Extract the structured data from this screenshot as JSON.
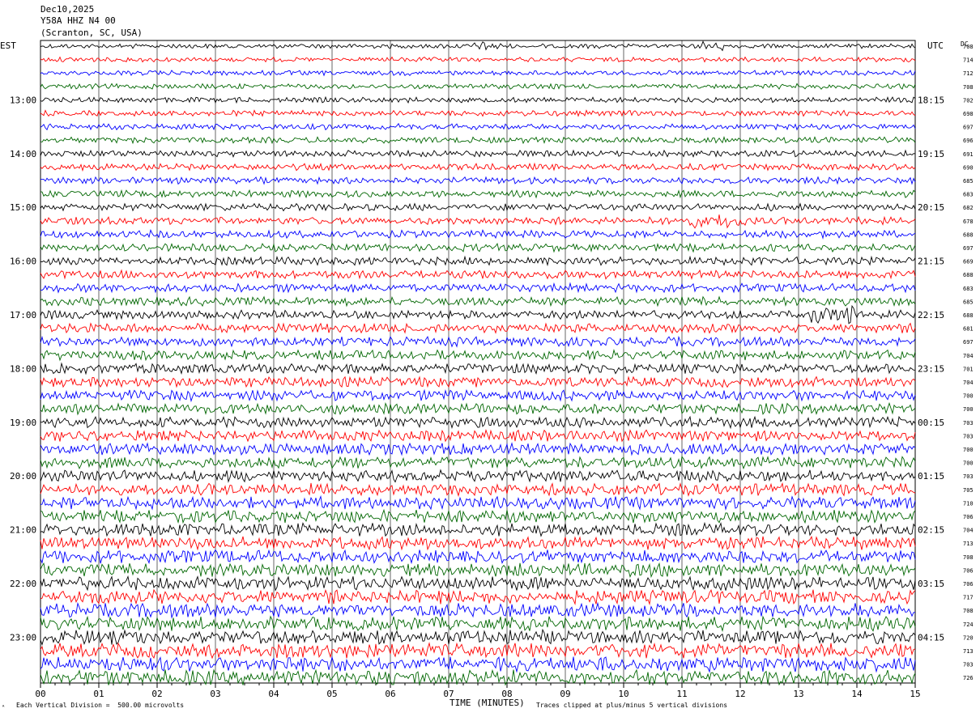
{
  "header": {
    "date": "Dec10,2025",
    "station": "Y58A HHZ N4 00",
    "location": "(Scranton, SC, USA)"
  },
  "left_zone_label": "EST",
  "right_zone_label": "UTC",
  "dc_label": "DC",
  "footer": {
    "x_axis_title": "TIME (MINUTES)",
    "vertical_division": "Each Vertical Division =  500.00 microvolts",
    "clip_note": "Traces clipped at plus/minus 5 vertical divisions"
  },
  "chart_data": {
    "type": "line",
    "title": "",
    "xlabel": "TIME (MINUTES)",
    "ylabel": "",
    "xlim": [
      0,
      15
    ],
    "x_ticks": [
      "00",
      "01",
      "02",
      "03",
      "04",
      "05",
      "06",
      "07",
      "08",
      "09",
      "10",
      "11",
      "12",
      "13",
      "14",
      "15"
    ],
    "trace_count": 48,
    "trace_colors": [
      "#000000",
      "#ff0000",
      "#0000ff",
      "#006600"
    ],
    "grid": "vertical lines at each minute",
    "left_time_labels": [
      {
        "trace": 4,
        "label": "13:00"
      },
      {
        "trace": 8,
        "label": "14:00"
      },
      {
        "trace": 12,
        "label": "15:00"
      },
      {
        "trace": 16,
        "label": "16:00"
      },
      {
        "trace": 20,
        "label": "17:00"
      },
      {
        "trace": 24,
        "label": "18:00"
      },
      {
        "trace": 28,
        "label": "19:00"
      },
      {
        "trace": 32,
        "label": "20:00"
      },
      {
        "trace": 36,
        "label": "21:00"
      },
      {
        "trace": 40,
        "label": "22:00"
      },
      {
        "trace": 44,
        "label": "23:00"
      }
    ],
    "right_time_labels": [
      {
        "trace": 4,
        "label": "18:15"
      },
      {
        "trace": 8,
        "label": "19:15"
      },
      {
        "trace": 12,
        "label": "20:15"
      },
      {
        "trace": 16,
        "label": "21:15"
      },
      {
        "trace": 20,
        "label": "22:15"
      },
      {
        "trace": 24,
        "label": "23:15"
      },
      {
        "trace": 28,
        "label": "00:15"
      },
      {
        "trace": 32,
        "label": "01:15"
      },
      {
        "trace": 36,
        "label": "02:15"
      },
      {
        "trace": 40,
        "label": "03:15"
      },
      {
        "trace": 44,
        "label": "04:15"
      }
    ],
    "dc_offsets": [
      "708",
      "714",
      "712",
      "708",
      "702",
      "698",
      "697",
      "696",
      "691",
      "690",
      "685",
      "683",
      "682",
      "678",
      "688",
      "697",
      "669",
      "688",
      "683",
      "685",
      "688",
      "681",
      "697",
      "704",
      "701",
      "704",
      "700",
      "700",
      "703",
      "703",
      "700",
      "700",
      "703",
      "705",
      "710",
      "706",
      "704",
      "713",
      "708",
      "706",
      "706",
      "717",
      "708",
      "724",
      "720",
      "713",
      "703",
      "726"
    ]
  }
}
